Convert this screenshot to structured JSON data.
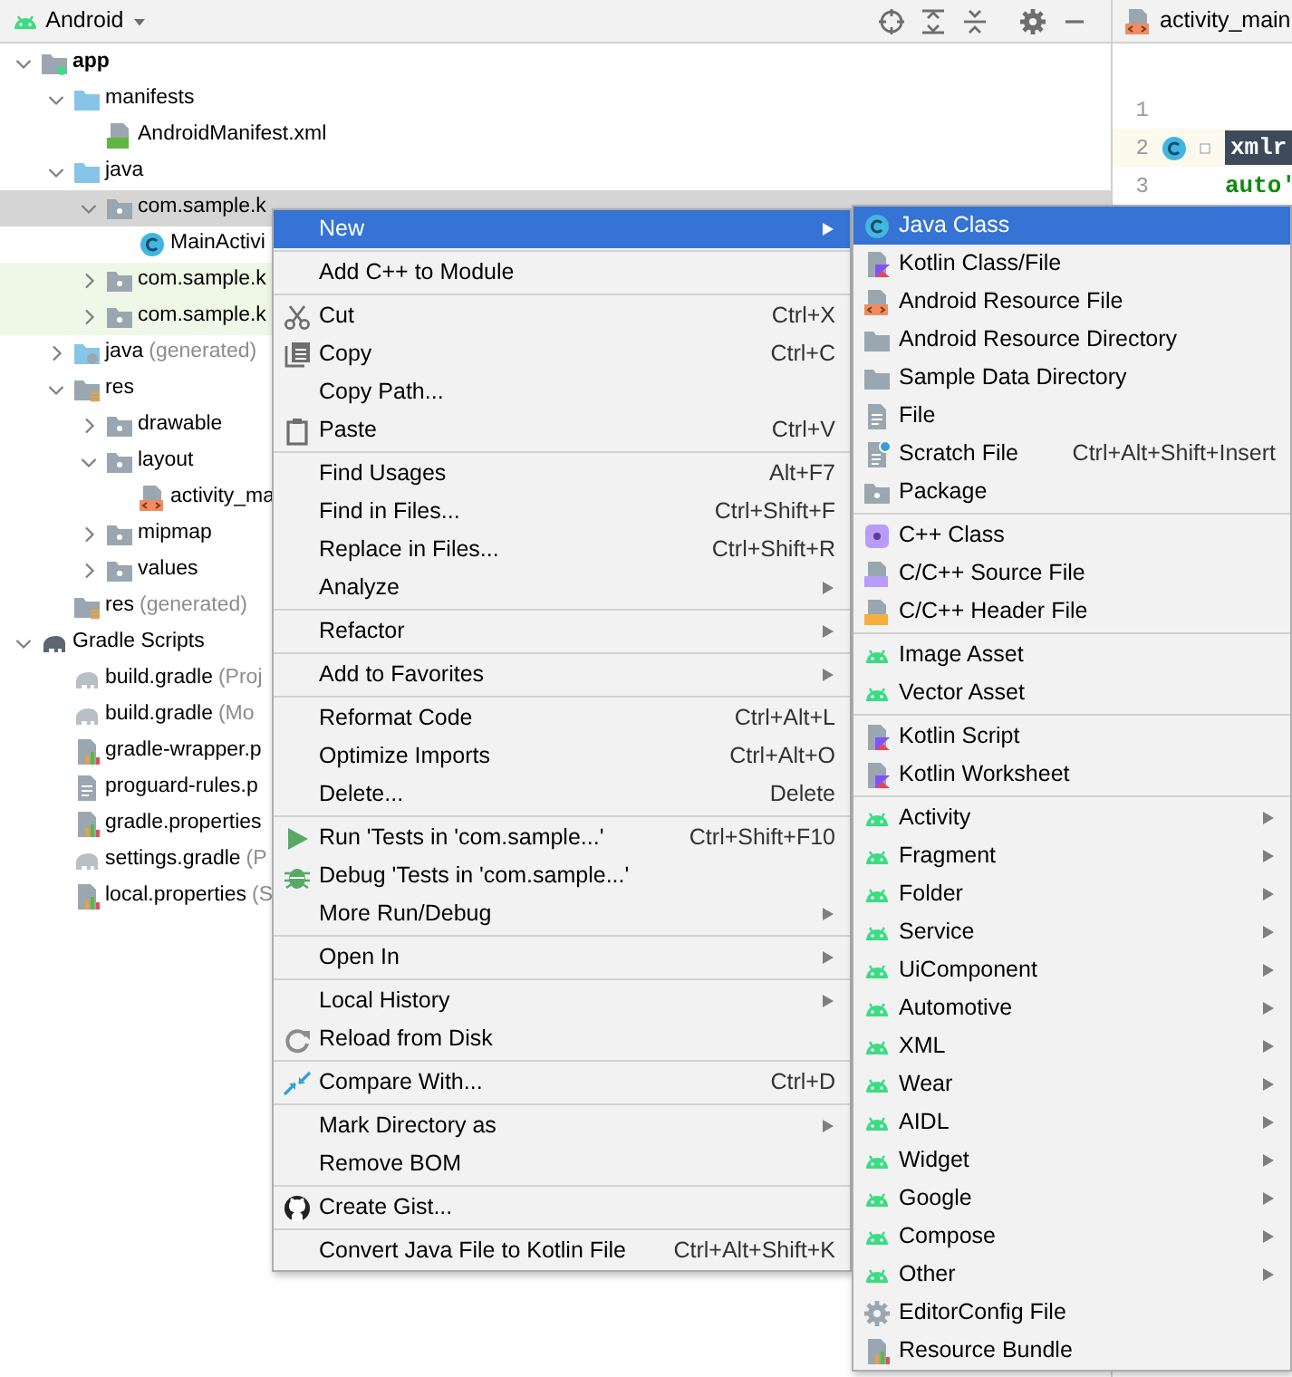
{
  "project_panel": {
    "view_selector": "Android",
    "tree": [
      {
        "label": "app",
        "kind": "module",
        "expanded": true,
        "selected": false,
        "children": [
          {
            "label": "manifests",
            "kind": "folder",
            "expanded": true,
            "selected": false,
            "children": [
              {
                "label": "AndroidManifest.xml",
                "kind": "manifest",
                "selected": false
              }
            ]
          },
          {
            "label": "java",
            "kind": "folder",
            "expanded": true,
            "selected": false,
            "children": [
              {
                "label": "com.sample.k",
                "kind": "package",
                "expanded": true,
                "selected": true,
                "children": [
                  {
                    "label": "MainActivi",
                    "kind": "class",
                    "selected": false
                  }
                ]
              },
              {
                "label": "com.sample.k",
                "kind": "test-package",
                "expanded": false,
                "selected": false
              },
              {
                "label": "com.sample.k",
                "kind": "test-package",
                "expanded": false,
                "selected": false
              }
            ]
          },
          {
            "label": "java",
            "hint": "(generated)",
            "kind": "generated-folder",
            "expanded": false,
            "selected": false
          },
          {
            "label": "res",
            "kind": "res-folder",
            "expanded": true,
            "selected": false,
            "children": [
              {
                "label": "drawable",
                "kind": "package",
                "expanded": false,
                "selected": false
              },
              {
                "label": "layout",
                "kind": "package",
                "expanded": true,
                "selected": false,
                "children": [
                  {
                    "label": "activity_ma",
                    "kind": "layout-file",
                    "selected": false
                  }
                ]
              },
              {
                "label": "mipmap",
                "kind": "package",
                "expanded": false,
                "selected": false
              },
              {
                "label": "values",
                "kind": "package",
                "expanded": false,
                "selected": false
              }
            ]
          },
          {
            "label": "res",
            "hint": "(generated)",
            "kind": "res-generated",
            "selected": false
          }
        ]
      },
      {
        "label": "Gradle Scripts",
        "kind": "gradle-root",
        "expanded": true,
        "selected": false,
        "children": [
          {
            "label": "build.gradle",
            "hint": "(Proj",
            "kind": "gradle",
            "selected": false
          },
          {
            "label": "build.gradle",
            "hint": "(Mo",
            "kind": "gradle",
            "selected": false
          },
          {
            "label": "gradle-wrapper.p",
            "kind": "properties",
            "selected": false
          },
          {
            "label": "proguard-rules.p",
            "kind": "text-file",
            "selected": false
          },
          {
            "label": "gradle.properties",
            "kind": "properties",
            "selected": false
          },
          {
            "label": "settings.gradle",
            "hint": "(P",
            "kind": "gradle",
            "selected": false
          },
          {
            "label": "local.properties",
            "hint": "(S",
            "kind": "properties",
            "selected": false
          }
        ]
      }
    ]
  },
  "editor": {
    "tab": "activity_main",
    "lines": [
      {
        "number": "1"
      },
      {
        "number": "2",
        "current": true,
        "text": "xmlr",
        "kind": "tag"
      },
      {
        "number": "3",
        "text": "auto'",
        "kind": "attribute"
      }
    ]
  },
  "context_menu": {
    "groups": [
      [
        {
          "label": "New",
          "kind": "plain",
          "submenu": true,
          "selected": true
        }
      ],
      [
        {
          "label": "Add C++ to Module",
          "kind": "plain",
          "selected": false
        }
      ],
      [
        {
          "label": "Cut",
          "kind": "cut",
          "shortcut": "Ctrl+X",
          "selected": false
        },
        {
          "label": "Copy",
          "kind": "copy",
          "shortcut": "Ctrl+C",
          "selected": false
        },
        {
          "label": "Copy Path...",
          "kind": "plain",
          "selected": false
        },
        {
          "label": "Paste",
          "kind": "paste",
          "shortcut": "Ctrl+V",
          "selected": false
        }
      ],
      [
        {
          "label": "Find Usages",
          "kind": "plain",
          "shortcut": "Alt+F7",
          "selected": false
        },
        {
          "label": "Find in Files...",
          "kind": "plain",
          "shortcut": "Ctrl+Shift+F",
          "selected": false
        },
        {
          "label": "Replace in Files...",
          "kind": "plain",
          "shortcut": "Ctrl+Shift+R",
          "selected": false
        },
        {
          "label": "Analyze",
          "kind": "plain",
          "submenu": true,
          "selected": false
        }
      ],
      [
        {
          "label": "Refactor",
          "kind": "plain",
          "submenu": true,
          "selected": false
        }
      ],
      [
        {
          "label": "Add to Favorites",
          "kind": "plain",
          "submenu": true,
          "selected": false
        }
      ],
      [
        {
          "label": "Reformat Code",
          "kind": "plain",
          "shortcut": "Ctrl+Alt+L",
          "selected": false
        },
        {
          "label": "Optimize Imports",
          "kind": "plain",
          "shortcut": "Ctrl+Alt+O",
          "selected": false
        },
        {
          "label": "Delete...",
          "kind": "plain",
          "shortcut": "Delete",
          "selected": false
        }
      ],
      [
        {
          "label": "Run 'Tests in 'com.sample...'",
          "kind": "run",
          "shortcut": "Ctrl+Shift+F10",
          "selected": false
        },
        {
          "label": "Debug 'Tests in 'com.sample...'",
          "kind": "debug",
          "selected": false
        },
        {
          "label": "More Run/Debug",
          "kind": "plain",
          "submenu": true,
          "selected": false
        }
      ],
      [
        {
          "label": "Open In",
          "kind": "plain",
          "submenu": true,
          "selected": false
        }
      ],
      [
        {
          "label": "Local History",
          "kind": "plain",
          "submenu": true,
          "selected": false
        },
        {
          "label": "Reload from Disk",
          "kind": "reload",
          "selected": false
        }
      ],
      [
        {
          "label": "Compare With...",
          "kind": "compare",
          "shortcut": "Ctrl+D",
          "selected": false
        }
      ],
      [
        {
          "label": "Mark Directory as",
          "kind": "plain",
          "submenu": true,
          "selected": false
        },
        {
          "label": "Remove BOM",
          "kind": "plain",
          "selected": false
        }
      ],
      [
        {
          "label": "Create Gist...",
          "kind": "gist",
          "selected": false
        }
      ],
      [
        {
          "label": "Convert Java File to Kotlin File",
          "kind": "plain",
          "shortcut": "Ctrl+Alt+Shift+K",
          "selected": false
        }
      ]
    ]
  },
  "new_submenu": {
    "groups": [
      [
        {
          "label": "Java Class",
          "kind": "java-class",
          "selected": true
        },
        {
          "label": "Kotlin Class/File",
          "kind": "kotlin-file",
          "selected": false
        },
        {
          "label": "Android Resource File",
          "kind": "resource-file",
          "selected": false
        },
        {
          "label": "Android Resource Directory",
          "kind": "directory",
          "selected": false
        },
        {
          "label": "Sample Data Directory",
          "kind": "directory",
          "selected": false
        },
        {
          "label": "File",
          "kind": "file",
          "selected": false
        },
        {
          "label": "Scratch File",
          "kind": "scratch",
          "shortcut": "Ctrl+Alt+Shift+Insert",
          "selected": false
        },
        {
          "label": "Package",
          "kind": "package",
          "selected": false
        }
      ],
      [
        {
          "label": "C++ Class",
          "kind": "cpp-class",
          "selected": false
        },
        {
          "label": "C/C++ Source File",
          "kind": "cpp-source",
          "selected": false
        },
        {
          "label": "C/C++ Header File",
          "kind": "cpp-header",
          "selected": false
        }
      ],
      [
        {
          "label": "Image Asset",
          "kind": "android",
          "selected": false
        },
        {
          "label": "Vector Asset",
          "kind": "android",
          "selected": false
        }
      ],
      [
        {
          "label": "Kotlin Script",
          "kind": "kotlin-script",
          "selected": false
        },
        {
          "label": "Kotlin Worksheet",
          "kind": "kotlin-script",
          "selected": false
        }
      ],
      [
        {
          "label": "Activity",
          "kind": "android",
          "submenu": true,
          "selected": false
        },
        {
          "label": "Fragment",
          "kind": "android",
          "submenu": true,
          "selected": false
        },
        {
          "label": "Folder",
          "kind": "android",
          "submenu": true,
          "selected": false
        },
        {
          "label": "Service",
          "kind": "android",
          "submenu": true,
          "selected": false
        },
        {
          "label": "UiComponent",
          "kind": "android",
          "submenu": true,
          "selected": false
        },
        {
          "label": "Automotive",
          "kind": "android",
          "submenu": true,
          "selected": false
        },
        {
          "label": "XML",
          "kind": "android",
          "submenu": true,
          "selected": false
        },
        {
          "label": "Wear",
          "kind": "android",
          "submenu": true,
          "selected": false
        },
        {
          "label": "AIDL",
          "kind": "android",
          "submenu": true,
          "selected": false
        },
        {
          "label": "Widget",
          "kind": "android",
          "submenu": true,
          "selected": false
        },
        {
          "label": "Google",
          "kind": "android",
          "submenu": true,
          "selected": false
        },
        {
          "label": "Compose",
          "kind": "android",
          "submenu": true,
          "selected": false
        },
        {
          "label": "Other",
          "kind": "android",
          "submenu": true,
          "selected": false
        },
        {
          "label": "EditorConfig File",
          "kind": "config",
          "selected": false
        },
        {
          "label": "Resource Bundle",
          "kind": "bundle",
          "selected": false
        }
      ]
    ]
  }
}
